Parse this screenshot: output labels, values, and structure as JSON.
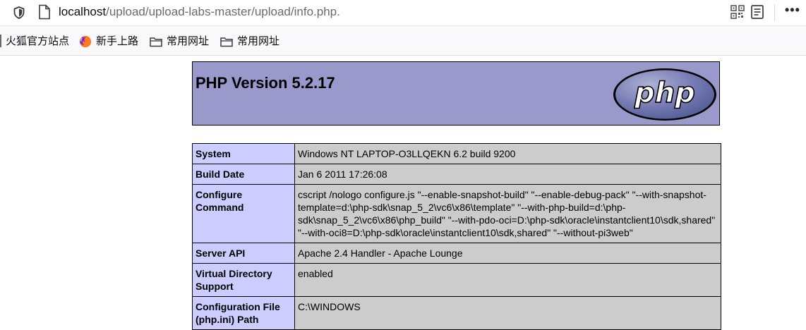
{
  "browser": {
    "url_host": "localhost",
    "url_path": "/upload/upload-labs-master/upload/info.php.",
    "icons": [
      "shield-icon",
      "page-icon",
      "qr-code-icon",
      "reader-view-icon",
      "more-menu-icon"
    ]
  },
  "bookmarks": [
    {
      "label": "火狐官方站点",
      "icon": "none"
    },
    {
      "label": "新手上路",
      "icon": "firefox-icon"
    },
    {
      "label": "常用网址",
      "icon": "folder-icon"
    },
    {
      "label": "常用网址",
      "icon": "folder-icon"
    }
  ],
  "phpinfo": {
    "title": "PHP Version 5.2.17",
    "logo_text": "php",
    "rows": [
      {
        "key": "System",
        "value": "Windows NT LAPTOP-O3LLQEKN 6.2 build 9200"
      },
      {
        "key": "Build Date",
        "value": "Jan 6 2011 17:26:08"
      },
      {
        "key": "Configure Command",
        "value": "cscript /nologo configure.js \"--enable-snapshot-build\" \"--enable-debug-pack\" \"--with-snapshot-template=d:\\php-sdk\\snap_5_2\\vc6\\x86\\template\" \"--with-php-build=d:\\php-sdk\\snap_5_2\\vc6\\x86\\php_build\" \"--with-pdo-oci=D:\\php-sdk\\oracle\\instantclient10\\sdk,shared\" \"--with-oci8=D:\\php-sdk\\oracle\\instantclient10\\sdk,shared\" \"--without-pi3web\""
      },
      {
        "key": "Server API",
        "value": "Apache 2.4 Handler - Apache Lounge"
      },
      {
        "key": "Virtual Directory Support",
        "value": "enabled"
      },
      {
        "key": "Configuration File (php.ini) Path",
        "value": "C:\\WINDOWS"
      }
    ]
  },
  "colors": {
    "header_bg": "#9999cc",
    "key_bg": "#ccccff",
    "value_bg": "#cccccc"
  }
}
